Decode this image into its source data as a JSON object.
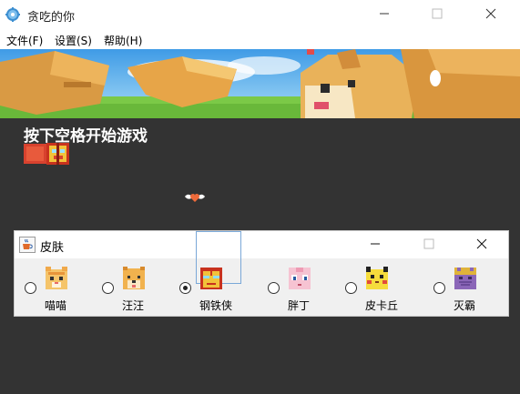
{
  "window": {
    "title": "贪吃的你",
    "icons": {
      "app": "gear-icon",
      "minimize": "minimize-icon",
      "maximize": "maximize-icon",
      "close": "close-icon"
    }
  },
  "menu": {
    "items": [
      {
        "label": "文件(F)"
      },
      {
        "label": "设置(S)"
      },
      {
        "label": "帮助(H)"
      }
    ]
  },
  "game": {
    "prompt": "按下空格开始游戏",
    "background_color": "#333333",
    "food_icon": "winged-heart-icon"
  },
  "skin_dialog": {
    "title": "皮肤",
    "icon": "java-cup-icon",
    "selected_index": 2,
    "options": [
      {
        "label": "喵喵",
        "icon": "cat-face-icon"
      },
      {
        "label": "汪汪",
        "icon": "dog-face-icon"
      },
      {
        "label": "钢铁侠",
        "icon": "iron-man-face-icon"
      },
      {
        "label": "胖丁",
        "icon": "jigglypuff-face-icon"
      },
      {
        "label": "皮卡丘",
        "icon": "pikachu-face-icon"
      },
      {
        "label": "灭霸",
        "icon": "thanos-face-icon"
      }
    ]
  }
}
